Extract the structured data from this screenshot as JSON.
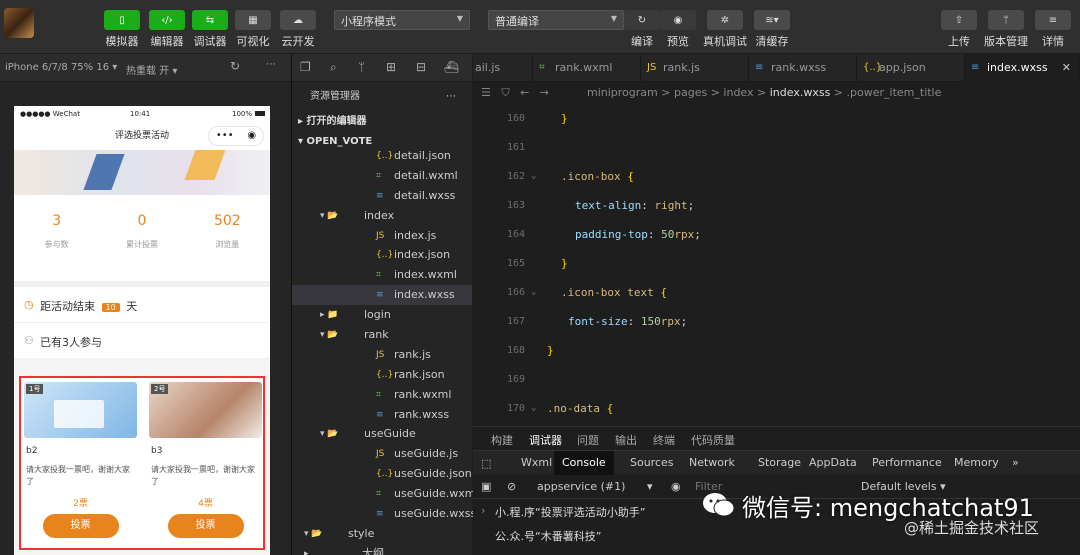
{
  "toolbar": {
    "buttons": [
      {
        "label": "模拟器",
        "icon": "phone-icon"
      },
      {
        "label": "编辑器",
        "icon": "code-icon"
      },
      {
        "label": "调试器",
        "icon": "debugger-icon"
      },
      {
        "label": "可视化",
        "icon": "layout-icon"
      },
      {
        "label": "云开发",
        "icon": "cloud-icon"
      }
    ],
    "mode_select": "小程序模式",
    "compile_select": "普通编译",
    "right_buttons": [
      {
        "label": "编译",
        "icon": "refresh-icon"
      },
      {
        "label": "预览",
        "icon": "eye-icon"
      },
      {
        "label": "真机调试",
        "icon": "bug-icon"
      },
      {
        "label": "清缓存",
        "icon": "layers-icon"
      },
      {
        "label": "上传",
        "icon": "upload-icon"
      },
      {
        "label": "版本管理",
        "icon": "branch-icon"
      },
      {
        "label": "详情",
        "icon": "menu-icon"
      }
    ]
  },
  "simulator": {
    "device": "iPhone 6/7/8 75% 16 ▾",
    "reload": "热重载 开 ▾",
    "status_left": "●●●●● WeChat",
    "status_time": "10:41",
    "status_right": "100%",
    "page_title": "评选投票活动",
    "stats": [
      {
        "value": "3",
        "label": "参与数"
      },
      {
        "value": "0",
        "label": "累计投票"
      },
      {
        "value": "502",
        "label": "浏览量"
      }
    ],
    "countdown_prefix": "距活动结束",
    "countdown_days": "10",
    "countdown_suffix": "天",
    "participants": "已有3人参与",
    "cards": [
      {
        "tag": "1号",
        "name": "b2",
        "desc": "请大家投我一票吧，谢谢大家了",
        "votes": "2票",
        "button": "投票"
      },
      {
        "tag": "2号",
        "name": "b3",
        "desc": "请大家投我一票吧，谢谢大家了",
        "votes": "4票",
        "button": "投票"
      }
    ]
  },
  "explorer": {
    "title": "资源管理器",
    "open_editors": "打开的编辑器",
    "project": "OPEN_VOTE",
    "items": [
      {
        "name": "detail.json",
        "type": "json",
        "indent": 2
      },
      {
        "name": "detail.wxml",
        "type": "wxml",
        "indent": 2
      },
      {
        "name": "detail.wxss",
        "type": "wxss",
        "indent": 2
      },
      {
        "name": "index",
        "type": "folder-open",
        "indent": 1
      },
      {
        "name": "index.js",
        "type": "js",
        "indent": 2
      },
      {
        "name": "index.json",
        "type": "json",
        "indent": 2
      },
      {
        "name": "index.wxml",
        "type": "wxml",
        "indent": 2
      },
      {
        "name": "index.wxss",
        "type": "wxss",
        "indent": 2,
        "selected": true
      },
      {
        "name": "login",
        "type": "folder",
        "indent": 1
      },
      {
        "name": "rank",
        "type": "folder-open",
        "indent": 1
      },
      {
        "name": "rank.js",
        "type": "js",
        "indent": 2
      },
      {
        "name": "rank.json",
        "type": "json",
        "indent": 2
      },
      {
        "name": "rank.wxml",
        "type": "wxml",
        "indent": 2
      },
      {
        "name": "rank.wxss",
        "type": "wxss",
        "indent": 2
      },
      {
        "name": "useGuide",
        "type": "folder-open",
        "indent": 1
      },
      {
        "name": "useGuide.js",
        "type": "js",
        "indent": 2
      },
      {
        "name": "useGuide.json",
        "type": "json",
        "indent": 2
      },
      {
        "name": "useGuide.wxml",
        "type": "wxml",
        "indent": 2
      },
      {
        "name": "useGuide.wxss",
        "type": "wxss",
        "indent": 2
      },
      {
        "name": "style",
        "type": "folder-open",
        "indent": 0
      },
      {
        "name": "大纲",
        "type": "section",
        "indent": 0
      }
    ]
  },
  "editor": {
    "tabs": [
      {
        "label": "ail.js",
        "type": "js"
      },
      {
        "label": "rank.wxml",
        "type": "wxml"
      },
      {
        "label": "rank.js",
        "type": "js"
      },
      {
        "label": "rank.wxss",
        "type": "wxss"
      },
      {
        "label": "app.json",
        "type": "json"
      },
      {
        "label": "index.wxss",
        "type": "wxss",
        "active": true
      }
    ],
    "breadcrumb": [
      "miniprogram",
      "pages",
      "index",
      "index.wxss",
      ".power_item_title"
    ],
    "lines": [
      {
        "n": "160",
        "indent": 1,
        "tokens": [
          {
            "t": "}",
            "c": "c-br"
          }
        ]
      },
      {
        "n": "161",
        "indent": 0,
        "tokens": []
      },
      {
        "n": "162",
        "indent": 1,
        "fold": true,
        "tokens": [
          {
            "t": ".icon-box ",
            "c": "c-sel"
          },
          {
            "t": "{",
            "c": "c-br"
          }
        ]
      },
      {
        "n": "163",
        "indent": 2,
        "tokens": [
          {
            "t": "text-align",
            "c": "c-prop"
          },
          {
            "t": ": ",
            "c": "c-punc"
          },
          {
            "t": "right",
            "c": "c-sel"
          },
          {
            "t": ";",
            "c": "c-punc"
          }
        ]
      },
      {
        "n": "164",
        "indent": 2,
        "tokens": [
          {
            "t": "padding-top",
            "c": "c-prop"
          },
          {
            "t": ": ",
            "c": "c-punc"
          },
          {
            "t": "50",
            "c": "c-num"
          },
          {
            "t": "rpx",
            "c": "c-sel"
          },
          {
            "t": ";",
            "c": "c-punc"
          }
        ]
      },
      {
        "n": "165",
        "indent": 1,
        "tokens": [
          {
            "t": "}",
            "c": "c-br"
          }
        ]
      },
      {
        "n": "166",
        "indent": 1,
        "fold": true,
        "tokens": [
          {
            "t": ".icon-box text ",
            "c": "c-sel"
          },
          {
            "t": "{",
            "c": "c-br"
          }
        ]
      },
      {
        "n": "167",
        "indent": 1.5,
        "tokens": [
          {
            "t": "font-size",
            "c": "c-prop"
          },
          {
            "t": ": ",
            "c": "c-punc"
          },
          {
            "t": "150",
            "c": "c-num"
          },
          {
            "t": "rpx",
            "c": "c-sel"
          },
          {
            "t": ";",
            "c": "c-punc"
          }
        ]
      },
      {
        "n": "168",
        "indent": 0,
        "tokens": [
          {
            "t": "}",
            "c": "c-br"
          }
        ]
      },
      {
        "n": "169",
        "indent": 0,
        "tokens": []
      },
      {
        "n": "170",
        "indent": 0,
        "fold": true,
        "tokens": [
          {
            "t": ".no-data ",
            "c": "c-sel"
          },
          {
            "t": "{",
            "c": "c-br"
          }
        ]
      }
    ]
  },
  "debug": {
    "tabs": [
      "构建",
      "调试器",
      "问题",
      "输出",
      "终端",
      "代码质量"
    ],
    "console_tabs": [
      "Wxml",
      "Console",
      "Sources",
      "Network",
      "Storage",
      "AppData",
      "Performance",
      "Memory",
      "»"
    ],
    "context": "appservice (#1)",
    "filter": "Filter",
    "levels": "Default levels ▾",
    "logs": [
      "小.程.序“投票评选活动小助手”",
      "公.众.号“木番薯科技”"
    ]
  },
  "watermark": {
    "main": "微信号: mengchatchat91",
    "sub": "@稀土掘金技术社区"
  },
  "colors": {
    "accent_orange": "#e8841c",
    "wechat_green": "#1aad19",
    "highlight_red": "#e33"
  }
}
